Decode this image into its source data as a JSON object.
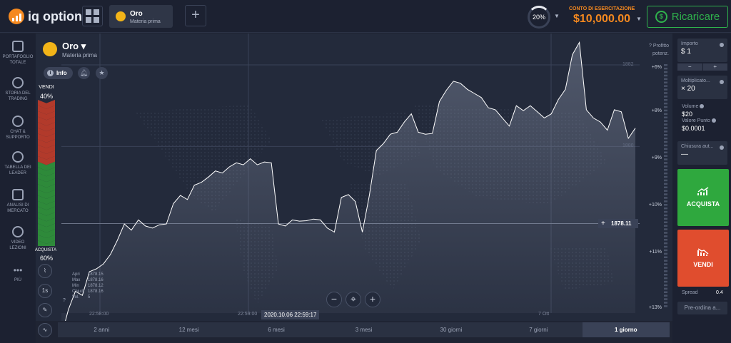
{
  "brand": {
    "name": "iq option"
  },
  "header": {
    "asset_tab": {
      "name": "Oro",
      "category": "Materia prima"
    },
    "add_tab": "+",
    "gauge_value": "20%",
    "account_label": "CONTO DI ESERCITAZIONE",
    "balance": "$10,000.00",
    "deposit_label": "Ricaricare"
  },
  "sidebar": {
    "items": [
      {
        "l1": "PORTAFOGLIO",
        "l2": "TOTALE",
        "icon": "briefcase-icon"
      },
      {
        "l1": "STORIA DEL",
        "l2": "TRADING",
        "icon": "history-icon"
      },
      {
        "l1": "CHAT &",
        "l2": "SUPPORTO",
        "icon": "chat-icon"
      },
      {
        "l1": "TABELLA DEI",
        "l2": "LEADER",
        "icon": "leaderboard-icon"
      },
      {
        "l1": "ANALISI DI",
        "l2": "MERCATO",
        "icon": "news-icon"
      },
      {
        "l1": "VIDEO",
        "l2": "LEZIONI",
        "icon": "play-icon"
      },
      {
        "l1": "PIÙ",
        "l2": "",
        "icon": "more-icon"
      }
    ]
  },
  "chart_header": {
    "title": "Oro",
    "subtitle": "Materia prima",
    "info_label": "Info"
  },
  "sentiment": {
    "sell_label": "VENDI",
    "sell_pct": "40%",
    "buy_label": "ACQUISTA",
    "buy_pct": "60%"
  },
  "tools": {
    "timeframe": "1s"
  },
  "ohlc": {
    "rows": [
      {
        "k": "Apri",
        "v": "1878.15"
      },
      {
        "k": "Max",
        "v": "1878.16"
      },
      {
        "k": "Min",
        "v": "1878.12"
      },
      {
        "k": "Chiudi",
        "v": "1878.16"
      },
      {
        "k": "Vol.",
        "v": "5"
      }
    ]
  },
  "chart_data": {
    "type": "area",
    "y_labels": [
      "1882",
      "1880"
    ],
    "current_price": "1878.11",
    "x_labels": [
      "22:58:00",
      "22:59:00",
      "7 Ott"
    ],
    "time_cursor": "2020.10.06 22:59:17",
    "profit_label": [
      "Profitto",
      "potenz."
    ],
    "profit_ticks": [
      "+6%",
      "+8%",
      "+9%",
      "+10%",
      "+11%",
      "+13%"
    ],
    "series_y": [
      1875.35,
      1876.0,
      1876.45,
      1876.35,
      1876.93,
      1877.0,
      1877.12,
      1877.35,
      1877.7,
      1878.1,
      1877.95,
      1878.2,
      1878.05,
      1878.0,
      1878.08,
      1878.1,
      1878.6,
      1878.8,
      1878.7,
      1879.05,
      1879.12,
      1879.25,
      1879.4,
      1879.35,
      1879.5,
      1879.6,
      1879.55,
      1879.7,
      1879.55,
      1879.62,
      1879.6,
      1878.1,
      1878.05,
      1878.2,
      1878.17,
      1878.18,
      1878.22,
      1878.2,
      1878.0,
      1877.9,
      1878.75,
      1878.82,
      1878.65,
      1877.9,
      1878.8,
      1879.9,
      1880.07,
      1880.3,
      1880.35,
      1880.6,
      1880.8,
      1880.35,
      1880.3,
      1880.32,
      1881.1,
      1881.38,
      1881.6,
      1881.55,
      1881.4,
      1881.3,
      1881.2,
      1880.95,
      1880.9,
      1880.7,
      1880.5,
      1881.0,
      1880.88,
      1881.0,
      1880.85,
      1880.7,
      1880.8,
      1881.15,
      1881.4,
      1882.25,
      1882.55,
      1880.9,
      1880.7,
      1880.6,
      1880.4,
      1880.9,
      1880.85,
      1880.2,
      1880.45
    ]
  },
  "zoom": {
    "minus": "−",
    "plus": "+"
  },
  "periods": [
    "2 anni",
    "12 mesi",
    "6 mesi",
    "3 mesi",
    "30 giorni",
    "7 giorni",
    "1 giorno"
  ],
  "panel": {
    "amount_label": "Importo",
    "amount_value": "$  1",
    "step_minus": "−",
    "step_plus": "+",
    "mult_label": "Moltiplicato...",
    "mult_value": "× 20",
    "volume_label": "Volume",
    "volume_value": "$20",
    "point_label": "Valore Punto",
    "point_value": "$0.0001",
    "autoclose_label": "Chiusura aut...",
    "autoclose_value": "—",
    "buy_label": "ACQUISTA",
    "sell_label": "VENDI",
    "spread_label": "Spread",
    "spread_value": "0.4",
    "preorder_label": "Pre-ordina a..."
  },
  "colors": {
    "buy": "#2fa83e",
    "sell": "#e04d2e",
    "accent": "#f5891f",
    "chart_line": "#ffffff"
  }
}
